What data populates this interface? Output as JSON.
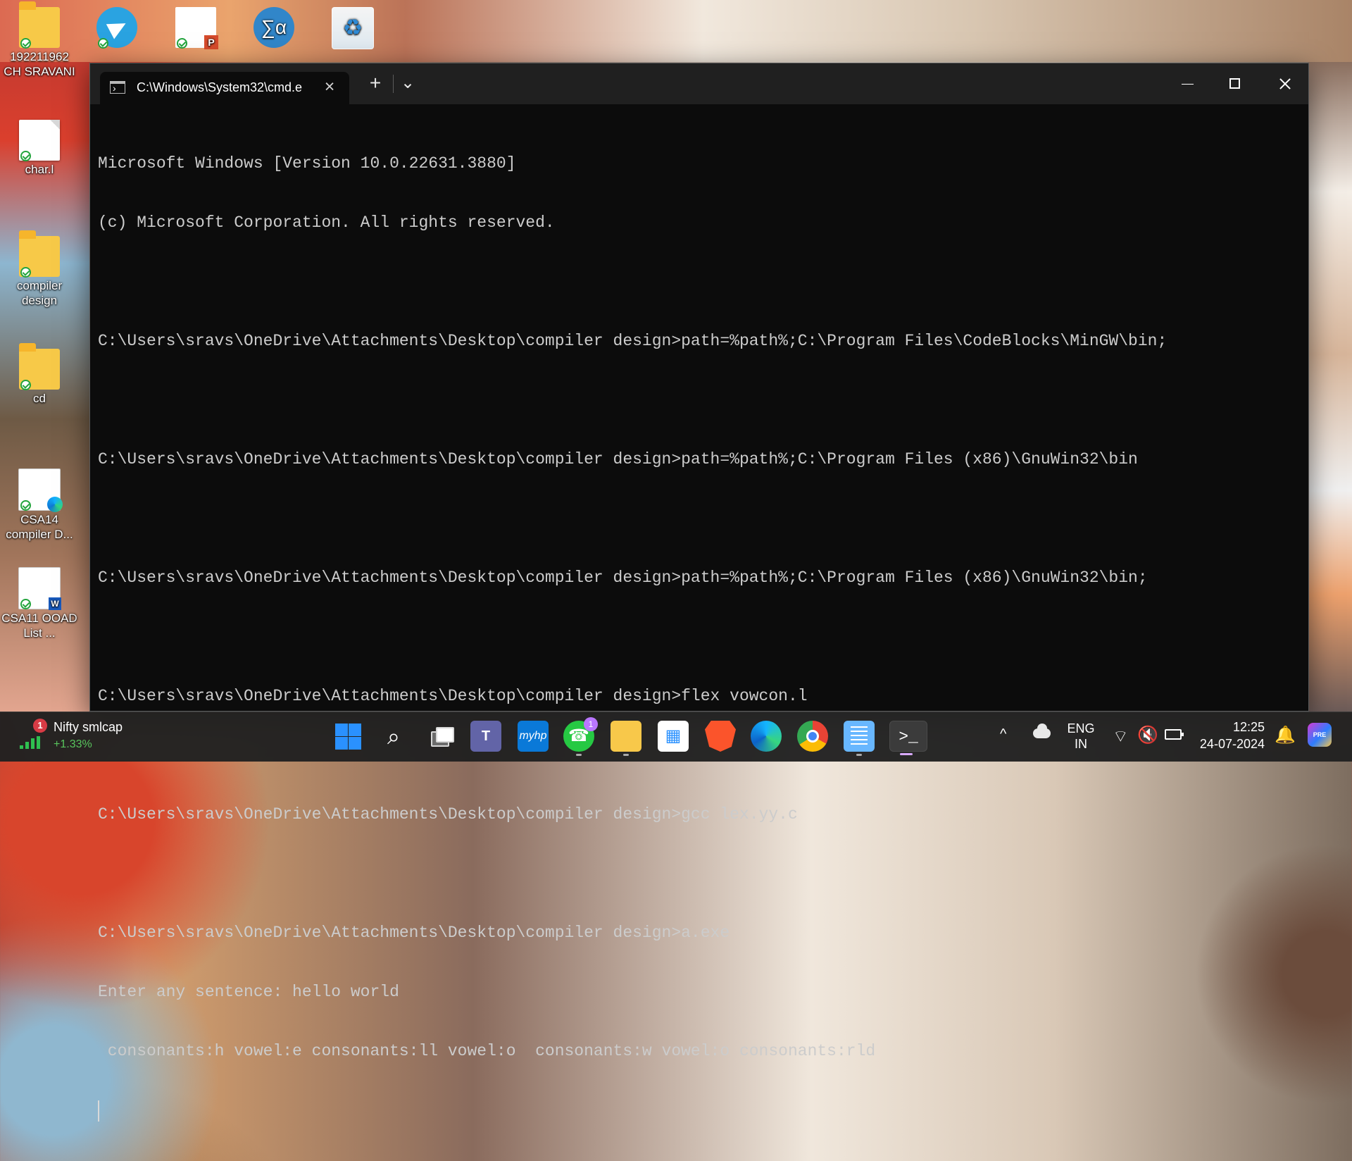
{
  "desktop": {
    "icons": [
      {
        "label": "192211962 CH SRAVANI",
        "icon": "folder-icon"
      },
      {
        "label": "",
        "icon": "telegram-icon"
      },
      {
        "label": "",
        "icon": "powerpoint-file-icon"
      },
      {
        "label": "∑α",
        "icon": "math-app-icon"
      },
      {
        "label": "♻",
        "icon": "recycle-bin-icon"
      },
      {
        "label": "char.l",
        "icon": "file-icon"
      },
      {
        "label": "compiler design",
        "icon": "folder-icon"
      },
      {
        "label": "cd",
        "icon": "folder-icon"
      },
      {
        "label": "CSA14 compiler D...",
        "icon": "edge-document-icon"
      },
      {
        "label": "CSA11 OOAD List ...",
        "icon": "word-document-icon"
      }
    ]
  },
  "terminal": {
    "tab_title": "C:\\Windows\\System32\\cmd.e",
    "tab_close": "×",
    "new_tab": "+",
    "dropdown": "⌄",
    "lines": [
      "Microsoft Windows [Version 10.0.22631.3880]",
      "(c) Microsoft Corporation. All rights reserved.",
      "",
      "C:\\Users\\sravs\\OneDrive\\Attachments\\Desktop\\compiler design>path=%path%;C:\\Program Files\\CodeBlocks\\MinGW\\bin;",
      "",
      "C:\\Users\\sravs\\OneDrive\\Attachments\\Desktop\\compiler design>path=%path%;C:\\Program Files (x86)\\GnuWin32\\bin",
      "",
      "C:\\Users\\sravs\\OneDrive\\Attachments\\Desktop\\compiler design>path=%path%;C:\\Program Files (x86)\\GnuWin32\\bin;",
      "",
      "C:\\Users\\sravs\\OneDrive\\Attachments\\Desktop\\compiler design>flex vowcon.l",
      "",
      "C:\\Users\\sravs\\OneDrive\\Attachments\\Desktop\\compiler design>gcc lex.yy.c",
      "",
      "C:\\Users\\sravs\\OneDrive\\Attachments\\Desktop\\compiler design>a.exe",
      "Enter any sentence: hello world",
      " consonants:h vowel:e consonants:ll vowel:o  consonants:w vowel:o consonants:rld"
    ]
  },
  "taskbar": {
    "widget": {
      "badge": "1",
      "name": "Nifty smlcap",
      "value": "+1.33%"
    },
    "apps": {
      "teams": "T",
      "myhp": "myhp",
      "whatsapp": "☎",
      "whatsapp_badge": "1",
      "store": "▦",
      "terminal": ">_"
    },
    "tray": {
      "chevron": "^",
      "language_line1": "ENG",
      "language_line2": "IN",
      "time": "12:25",
      "date": "24-07-2024",
      "copilot_badge": "PRE"
    }
  },
  "colors": {
    "terminal_background": "#0c0c0c",
    "terminal_text": "#cccccc",
    "taskbar_background": "#202020",
    "windows_blue": "#2a91ff"
  }
}
